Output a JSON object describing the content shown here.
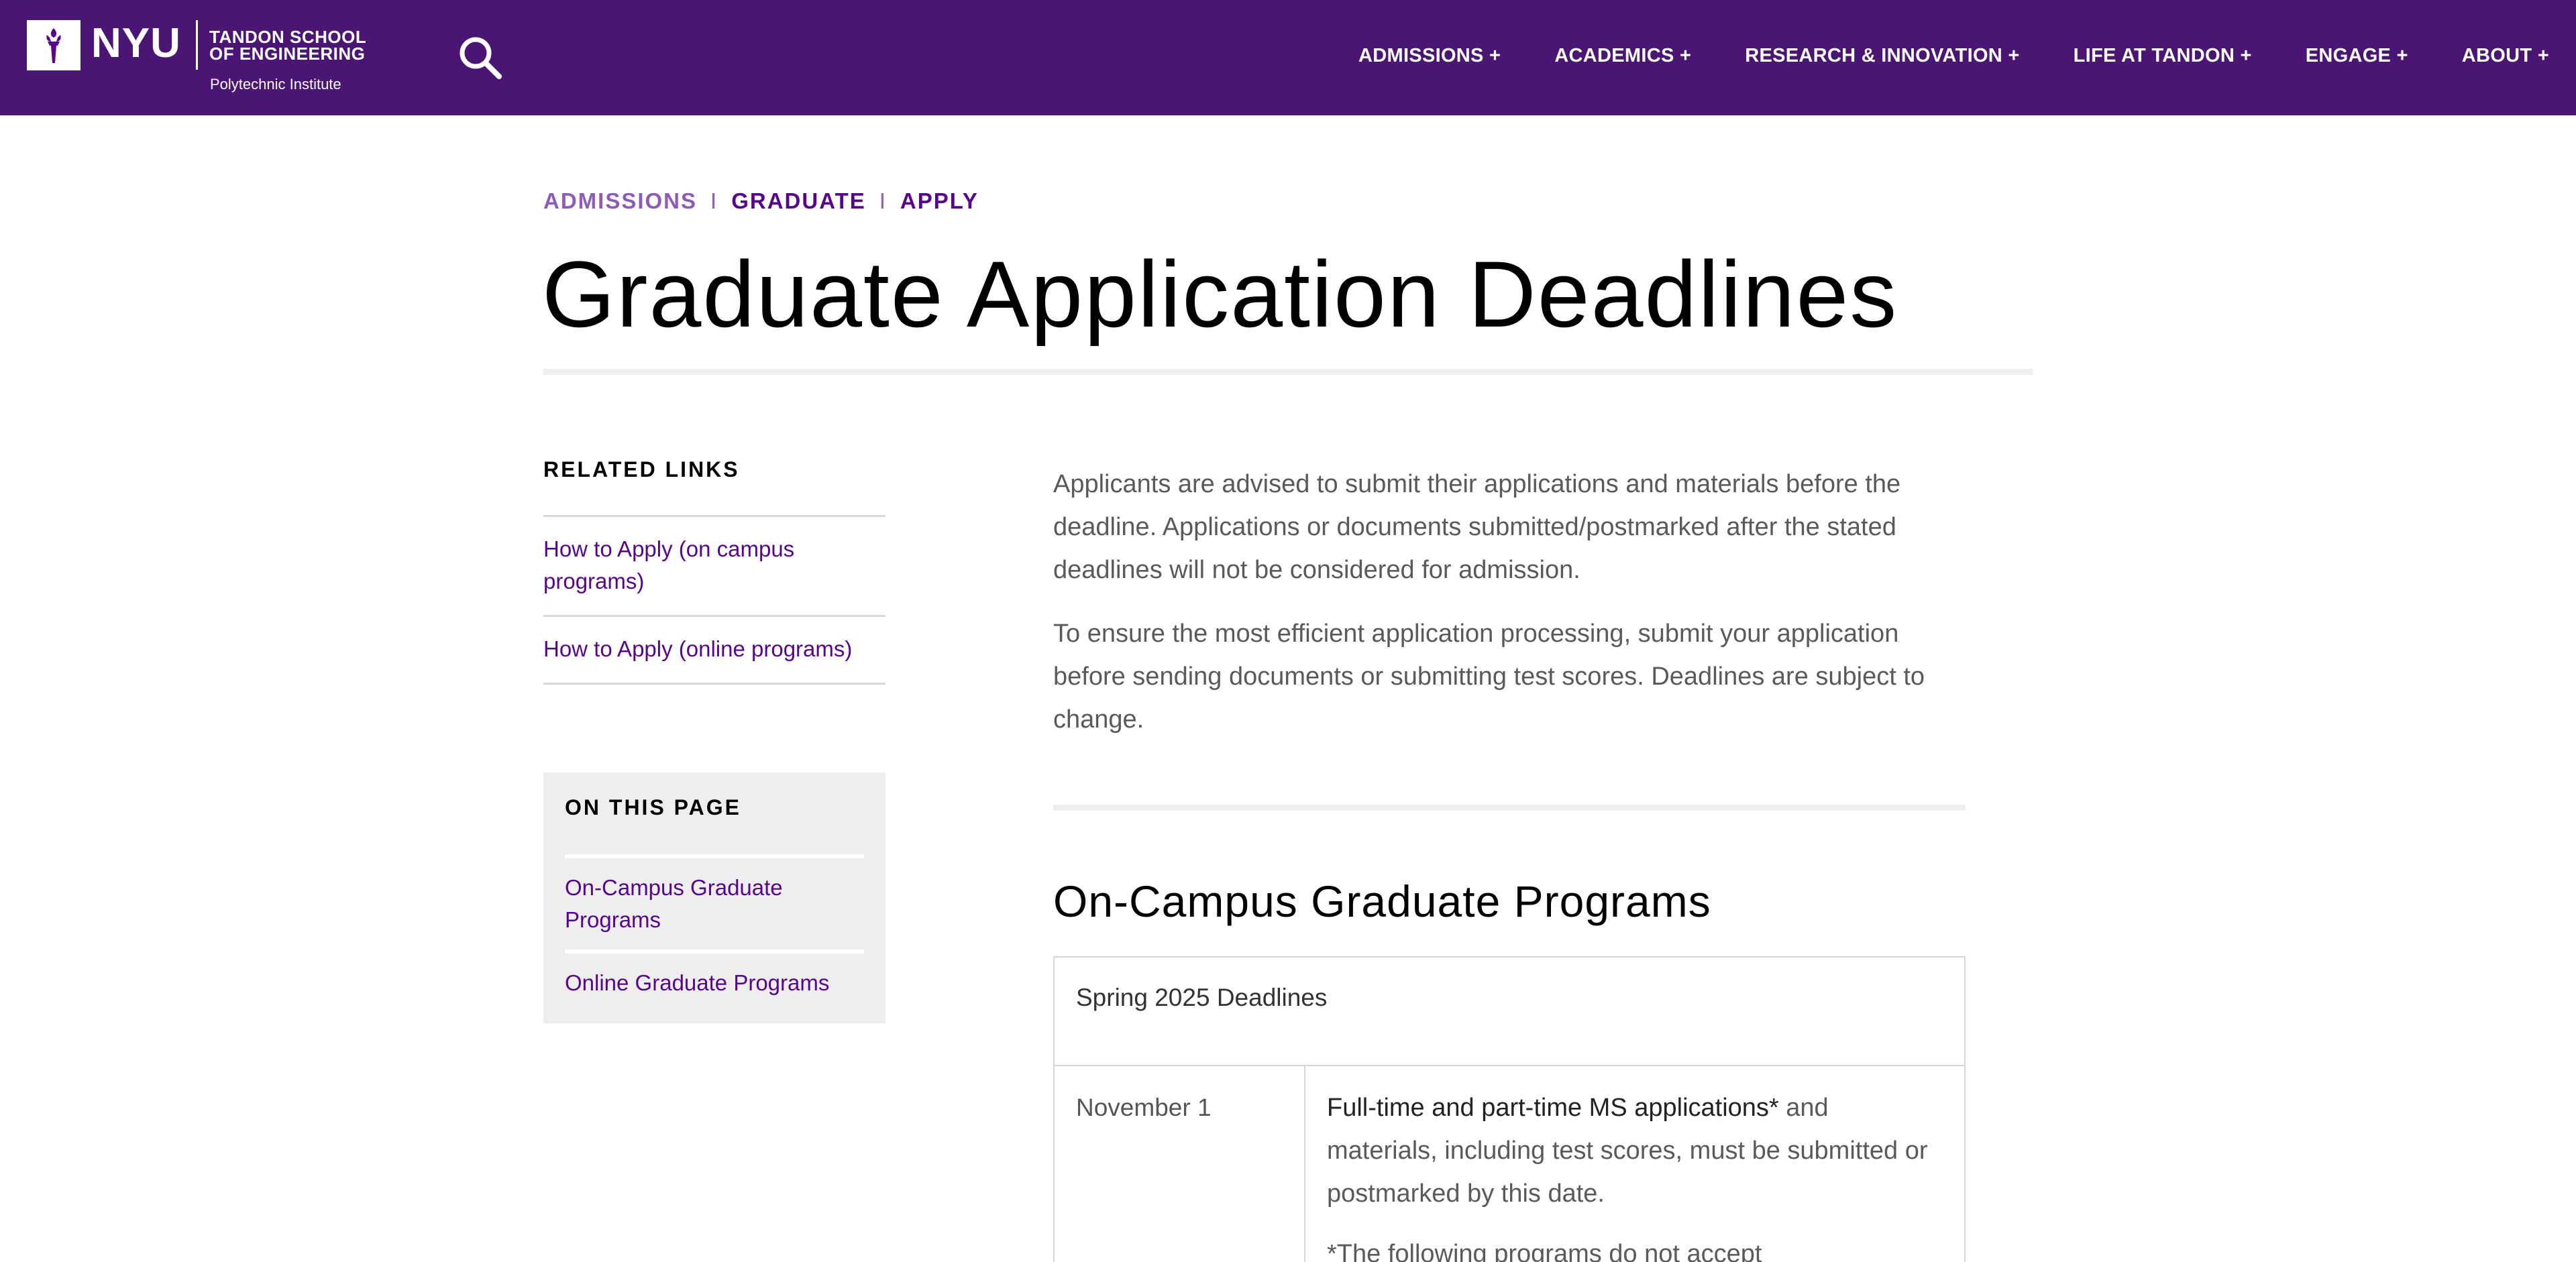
{
  "header": {
    "logo_nyu": "NYU",
    "logo_school_line1": "TANDON SCHOOL",
    "logo_school_line2": "OF ENGINEERING",
    "logo_sub": "Polytechnic Institute",
    "search_icon": "search-icon",
    "nav": [
      {
        "label": "ADMISSIONS +"
      },
      {
        "label": "ACADEMICS +"
      },
      {
        "label": "RESEARCH & INNOVATION +"
      },
      {
        "label": "LIFE AT TANDON +"
      },
      {
        "label": "ENGAGE +"
      },
      {
        "label": "ABOUT +"
      }
    ],
    "bg_color": "#4b1673"
  },
  "breadcrumb": [
    {
      "label": "ADMISSIONS"
    },
    {
      "label": "GRADUATE"
    },
    {
      "label": "APPLY"
    }
  ],
  "breadcrumb_separator": "I",
  "page_title": "Graduate Application Deadlines",
  "sidebar": {
    "related_heading": "RELATED LINKS",
    "related_links": [
      {
        "label": "How to Apply (on campus programs)"
      },
      {
        "label": "How to Apply (online programs)"
      }
    ],
    "on_this_page_heading": "ON THIS PAGE",
    "on_this_page_links": [
      {
        "label": "On-Campus Graduate Programs"
      },
      {
        "label": "Online Graduate Programs"
      }
    ]
  },
  "main": {
    "paragraphs": [
      "Applicants are advised to submit their applications and materials before the deadline. Applications or documents submitted/postmarked after the stated deadlines will not be considered for admission.",
      "To ensure the most efficient application processing, submit your application before sending documents or submitting test scores. Deadlines are subject to change."
    ],
    "section_title": "On-Campus Graduate Programs",
    "table": {
      "caption": "Spring 2025 Deadlines",
      "rows": [
        {
          "date": "November 1",
          "desc_strong": "Full-time and part-time MS applications*",
          "desc_rest": " and materials, including test scores, must be submitted or postmarked by this date.",
          "note": "*The following programs do not accept"
        }
      ]
    }
  },
  "colors": {
    "link": "#57068c",
    "breadcrumb_first": "#8e5bb5",
    "rule": "#eeeeee"
  }
}
